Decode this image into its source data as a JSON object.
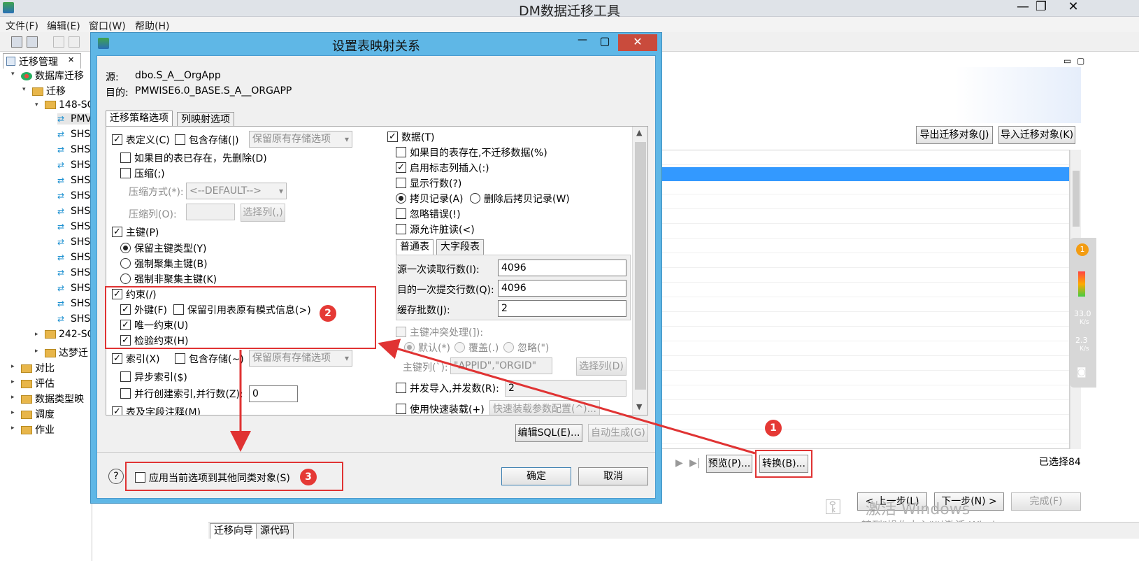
{
  "window": {
    "title": "DM数据迁移工具",
    "min_icon": "—",
    "max_icon": "❐",
    "close_icon": "✕"
  },
  "menu": [
    "文件(F)",
    "编辑(E)",
    "窗口(W)",
    "帮助(H)"
  ],
  "left_panel": {
    "tab_label": "迁移管理",
    "tab_close": "✕",
    "tree": [
      {
        "label": "数据库迁移",
        "level": 0,
        "type": "db"
      },
      {
        "label": "迁移",
        "level": 1,
        "type": "folder"
      },
      {
        "label": "148-SQ",
        "level": 2,
        "type": "folder"
      },
      {
        "label": "PMV",
        "level": 3,
        "type": "item"
      },
      {
        "label": "SHS",
        "level": 3,
        "type": "item"
      },
      {
        "label": "SHS",
        "level": 3,
        "type": "item"
      },
      {
        "label": "SHS",
        "level": 3,
        "type": "item"
      },
      {
        "label": "SHS",
        "level": 3,
        "type": "item"
      },
      {
        "label": "SHS",
        "level": 3,
        "type": "item"
      },
      {
        "label": "SHS",
        "level": 3,
        "type": "item"
      },
      {
        "label": "SHS",
        "level": 3,
        "type": "item"
      },
      {
        "label": "SHS",
        "level": 3,
        "type": "item"
      },
      {
        "label": "SHS",
        "level": 3,
        "type": "item"
      },
      {
        "label": "SHS",
        "level": 3,
        "type": "item"
      },
      {
        "label": "SHS",
        "level": 3,
        "type": "item"
      },
      {
        "label": "SHS",
        "level": 3,
        "type": "item"
      },
      {
        "label": "SHS",
        "level": 3,
        "type": "item"
      },
      {
        "label": "242-SQ",
        "level": 2,
        "type": "folder"
      },
      {
        "label": "达梦迁",
        "level": 2,
        "type": "folder"
      },
      {
        "label": "对比",
        "level": 0,
        "type": "folder"
      },
      {
        "label": "评估",
        "level": 0,
        "type": "folder"
      },
      {
        "label": "数据类型映",
        "level": 0,
        "type": "folder"
      },
      {
        "label": "调度",
        "level": 0,
        "type": "folder"
      },
      {
        "label": "作业",
        "level": 0,
        "type": "folder"
      }
    ]
  },
  "right_area": {
    "export_btn": "导出迁移对象(J)",
    "import_btn": "导入迁移对象(K)",
    "preview_btn": "预览(P)...",
    "convert_btn": "转换(B)...",
    "selected_count": "已选择84",
    "prev_btn": "< 上一步(L)",
    "next_btn": "下一步(N) >",
    "finish_btn": "完成(F)",
    "bottom_tabs": [
      "迁移向导",
      "源代码"
    ],
    "watermark_title": "激活 Windows",
    "watermark_sub": "转到\"操作中心\"以激活 Windows。",
    "side_widget": {
      "badge": "1",
      "up_speed": "33.0",
      "up_unit": "K/s",
      "down_speed": "2.3",
      "down_unit": "K/s"
    }
  },
  "dialog": {
    "title": "设置表映射关系",
    "source_label": "源:",
    "source_value": "dbo.S_A__OrgApp",
    "target_label": "目的:",
    "target_value": "PMWISE6.0_BASE.S_A__ORGAPP",
    "tabs": [
      "迁移策略选项",
      "列映射选项"
    ],
    "left": {
      "table_def": "表定义(C)",
      "include_storage": "包含存储(|)",
      "storage_select": "保留原有存储选项",
      "drop_if_exists": "如果目的表已存在，先删除(D)",
      "compress": "压缩(;)",
      "compress_method_label": "压缩方式(*):",
      "compress_method_value": "<--DEFAULT-->",
      "compress_cols_label": "压缩列(O):",
      "select_cols_btn": "选择列(,)",
      "primary_key": "主键(P)",
      "pk_keep_type": "保留主键类型(Y)",
      "pk_force_cluster": "强制聚集主键(B)",
      "pk_force_noncluster": "强制非聚集主键(K)",
      "constraint": "约束(/)",
      "foreign_key": "外键(F)",
      "keep_ref_schema": "保留引用表原有模式信息(>)",
      "unique": "唯一约束(U)",
      "check": "检验约束(H)",
      "index": "索引(X)",
      "index_include_storage": "包含存储(~)",
      "index_storage_select": "保留原有存储选项",
      "async_index": "异步索引($)",
      "parallel_index": "并行创建索引,并行数(Z):",
      "parallel_value": "0",
      "table_comment": "表及字段注释(M)"
    },
    "right": {
      "data": "数据(T)",
      "skip_if_exists": "如果目的表存在,不迁移数据(%)",
      "identity_insert": "启用标志列插入(:)",
      "show_rows": "显示行数(?)",
      "copy_records": "拷贝记录(A)",
      "delete_then_copy": "删除后拷贝记录(W)",
      "ignore_errors": "忽略错误(!)",
      "dirty_read": "源允许脏读(<)",
      "subtabs": [
        "普通表",
        "大字段表"
      ],
      "read_rows_label": "源一次读取行数(I):",
      "read_rows_value": "4096",
      "commit_rows_label": "目的一次提交行数(Q):",
      "commit_rows_value": "4096",
      "cache_batches_label": "缓存批数(J):",
      "cache_batches_value": "2",
      "pk_conflict": "主键冲突处理(]):",
      "conflict_default": "默认(*)",
      "conflict_overwrite": "覆盖(.)",
      "conflict_ignore": "忽略(\")",
      "pk_cols_label": "主键列(`):",
      "pk_cols_value": "\"APPID\",\"ORGID\"",
      "select_cols_btn": "选择列(D)",
      "concurrent_import": "并发导入,并发数(R):",
      "concurrent_value": "2",
      "fast_load": "使用快速装载(+)",
      "fast_load_btn": "快速装载参数配置(^)..."
    },
    "edit_sql_btn": "编辑SQL(E)...",
    "auto_gen_btn": "自动生成(G)",
    "help_icon": "?",
    "apply_all": "应用当前选项到其他同类对象(S)",
    "ok_btn": "确定",
    "cancel_btn": "取消"
  },
  "annotations": [
    "1",
    "2",
    "3"
  ]
}
